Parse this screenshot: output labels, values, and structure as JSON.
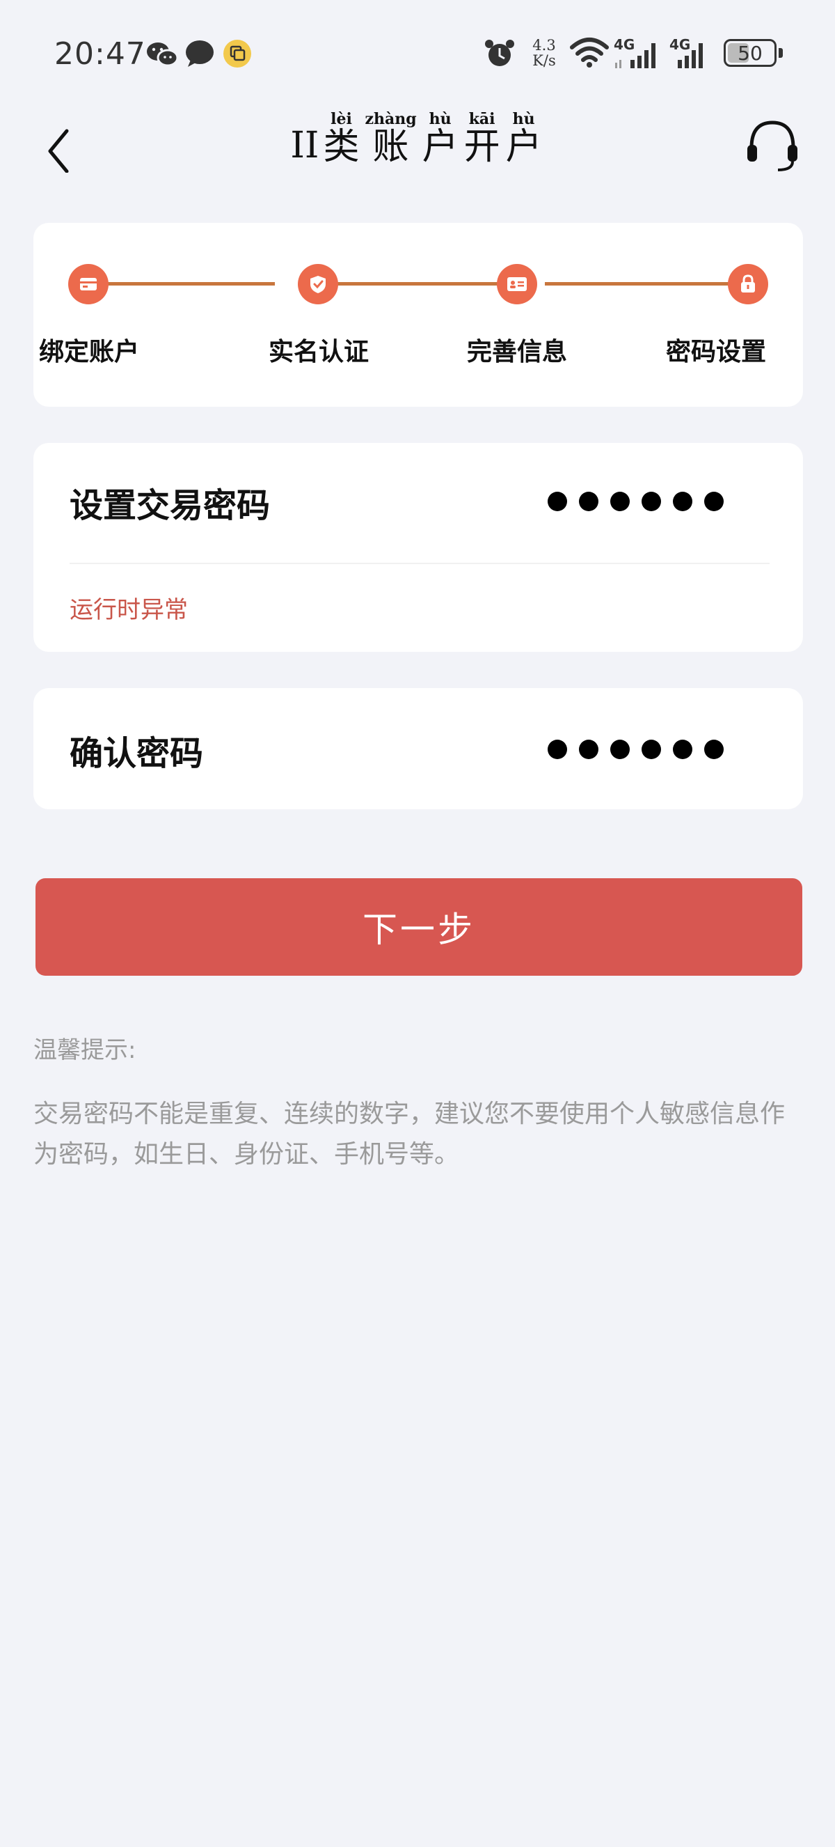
{
  "status_bar": {
    "time": "20:47",
    "network_speed": "4.3",
    "network_speed_unit": "K/s",
    "signal1_label": "4G",
    "signal2_label": "4G",
    "battery": "50",
    "icons": [
      "wechat-icon",
      "message-icon",
      "clone-icon",
      "alarm-icon",
      "wifi-icon",
      "signal-icon",
      "battery-icon"
    ]
  },
  "nav": {
    "title_prefix": "II",
    "title_chars": [
      {
        "pinyin": "lèi",
        "char": "类"
      },
      {
        "pinyin": "zhàng",
        "char": "账"
      },
      {
        "pinyin": "hù",
        "char": "户"
      },
      {
        "pinyin": "kāi",
        "char": "开"
      },
      {
        "pinyin": "hù",
        "char": "户"
      }
    ],
    "back_icon": "back-arrow-icon",
    "support_icon": "headset-icon"
  },
  "steps": [
    {
      "label": "绑定账户",
      "icon": "card-icon"
    },
    {
      "label": "实名认证",
      "icon": "shield-check-icon"
    },
    {
      "label": "完善信息",
      "icon": "id-card-icon"
    },
    {
      "label": "密码设置",
      "icon": "lock-icon"
    }
  ],
  "password": {
    "label": "设置交易密码",
    "mask_count": 6,
    "error": "运行时异常"
  },
  "confirm": {
    "label": "确认密码",
    "mask_count": 6
  },
  "next_button": "下一步",
  "tips": {
    "title": "温馨提示:",
    "body": "交易密码不能是重复、连续的数字，建议您不要使用个人敏感信息作为密码，如生日、身份证、手机号等。"
  },
  "colors": {
    "accent": "#d75751",
    "step_dot": "#ec6a4c",
    "step_line": "#c8763d",
    "error": "#c9564a",
    "background": "#f2f3f8"
  }
}
